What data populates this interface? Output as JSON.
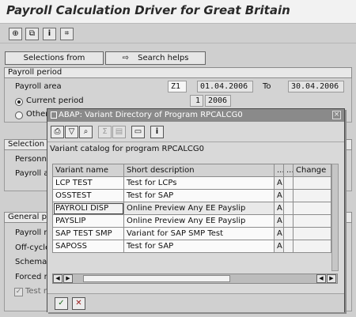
{
  "title": "Payroll Calculation Driver for Great Britain",
  "buttons": {
    "selections_from": "Selections from",
    "search_helps": "Search helps"
  },
  "payroll_period": {
    "header": "Payroll period",
    "area_label": "Payroll area",
    "area_value": "Z1",
    "from_date": "01.04.2006",
    "to_label": "To",
    "to_date": "30.04.2006",
    "current_label": "Current period",
    "period_num": "1",
    "period_year": "2006",
    "other_label": "Other"
  },
  "selection": {
    "header": "Selection",
    "personnel_label": "Personn",
    "payroll_a_label": "Payroll a"
  },
  "general": {
    "header": "General pr",
    "rows": [
      "Payroll r",
      "Off-cycle",
      "Schema",
      "Forced r",
      "Test r"
    ]
  },
  "dialog": {
    "title": "ABAP: Variant Directory of Program RPCALCG0",
    "catalog": "Variant catalog for program RPCALCG0",
    "columns": [
      "Variant name",
      "Short description",
      "...",
      "...",
      "Change"
    ],
    "rows": [
      {
        "name": "LCP TEST",
        "desc": "Test for LCPs",
        "flag": "A"
      },
      {
        "name": "OSSTEST",
        "desc": "Test for SAP",
        "flag": "A"
      },
      {
        "name": "PAYROLI DISP",
        "desc": "Online Preview Any EE Payslip",
        "flag": "A"
      },
      {
        "name": "PAYSLIP",
        "desc": "Online Preview Any EE Payslip",
        "flag": "A"
      },
      {
        "name": "SAP TEST SMP",
        "desc": "Variant for SAP SMP Test",
        "flag": "A"
      },
      {
        "name": "SAPOSS",
        "desc": "Test for SAP",
        "flag": "A"
      }
    ]
  },
  "icons": {
    "execute": "execute-icon",
    "variant": "get-variant-icon",
    "info": "info-icon",
    "fullscreen": "fullscreen-icon",
    "confirm": "check-icon",
    "cancel": "cancel-icon"
  }
}
